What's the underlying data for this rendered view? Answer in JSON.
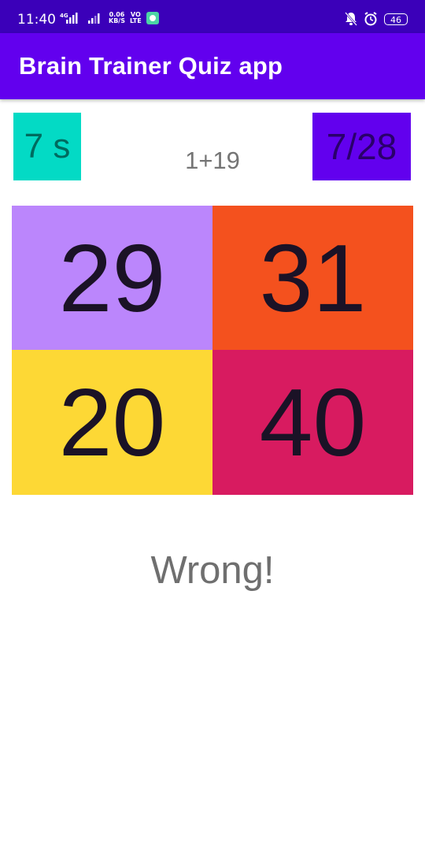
{
  "status_bar": {
    "time": "11:40",
    "network": "4G",
    "speed_value": "0.06",
    "speed_unit": "KB/S",
    "volte_top": "VO",
    "volte_bottom": "LTE",
    "battery": "46",
    "icons": [
      "signal-icon",
      "wifi-icon",
      "notification-off-icon",
      "alarm-icon",
      "battery-icon"
    ]
  },
  "app_bar": {
    "title": "Brain Trainer Quiz app",
    "color": "#6200ee"
  },
  "game": {
    "timer": "7 s",
    "question": "1+19",
    "score": "7/28",
    "answers": [
      {
        "value": "29",
        "color": "#bb86fc"
      },
      {
        "value": "31",
        "color": "#f4511e"
      },
      {
        "value": "20",
        "color": "#fdd835"
      },
      {
        "value": "40",
        "color": "#d81b60"
      }
    ],
    "result": "Wrong!"
  },
  "colors": {
    "status_bar": "#3b00b9",
    "timer_bg": "#03dac5",
    "score_bg": "#6200ee"
  }
}
